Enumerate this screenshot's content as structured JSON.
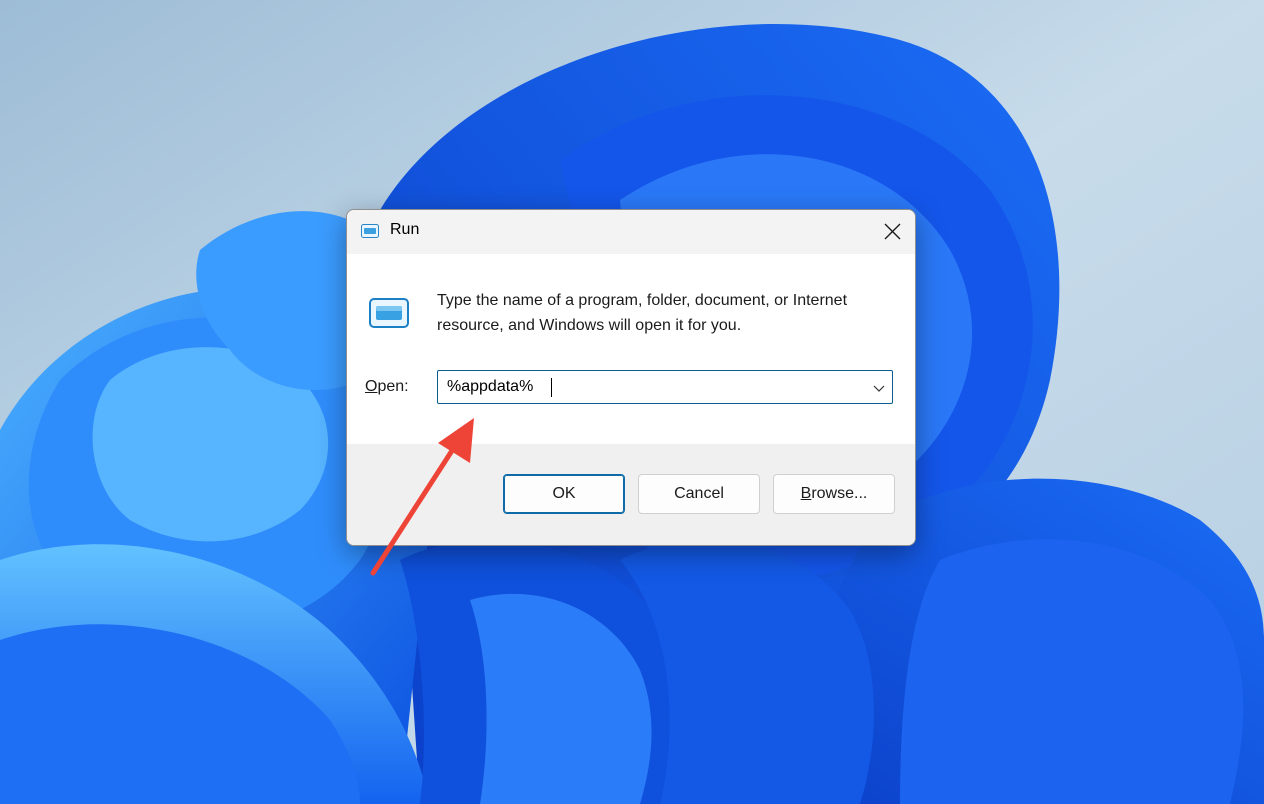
{
  "dialog": {
    "title": "Run",
    "description": "Type the name of a program, folder, document, or Internet resource, and Windows will open it for you.",
    "open_label_prefix": "O",
    "open_label_rest": "pen:",
    "input_value": "%appdata%",
    "buttons": {
      "ok": "OK",
      "cancel": "Cancel",
      "browse_prefix": "B",
      "browse_rest": "rowse..."
    }
  },
  "colors": {
    "annotation_arrow": "#ee4437",
    "input_border": "#0e5c8f",
    "wallpaper_blue": "#1a6ff0"
  },
  "icons": {
    "title": "run-app-icon",
    "body": "run-app-icon",
    "close": "close-icon",
    "dropdown": "chevron-down-icon"
  }
}
